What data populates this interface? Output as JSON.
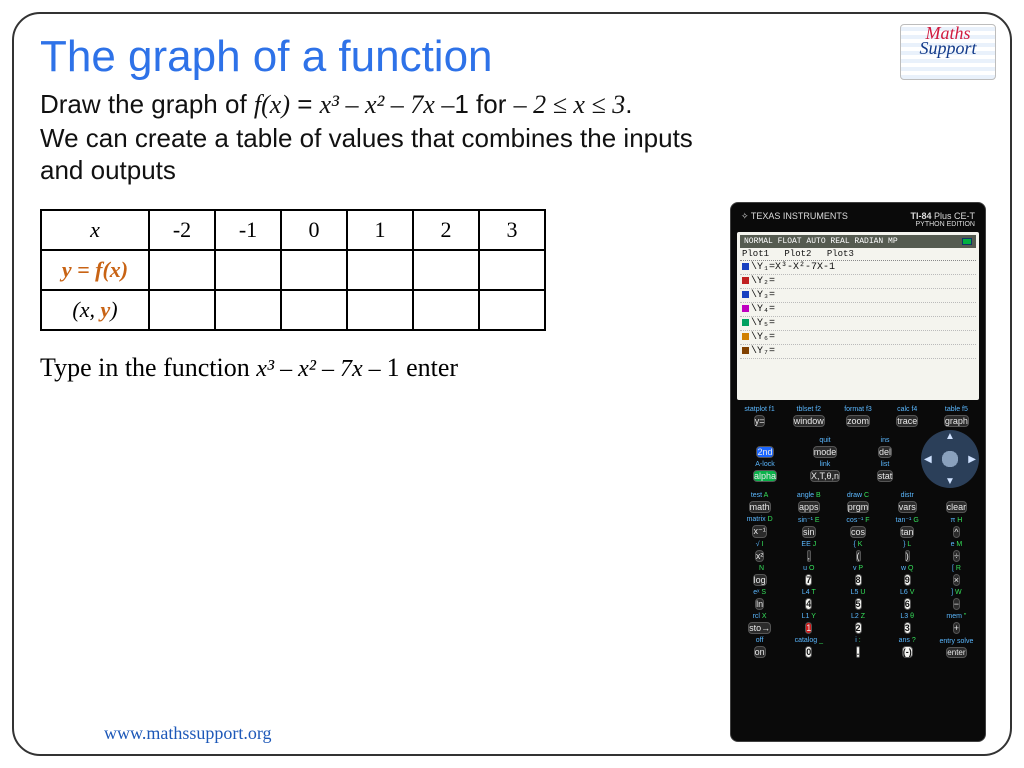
{
  "title": "The graph of a function",
  "logo": {
    "line1": "Maths",
    "line2": "Support"
  },
  "instruction": {
    "prefix": "Draw the graph of ",
    "fx_label": "f(x)",
    "equals": " = ",
    "expr_html": "x³ – x² – 7x –",
    "const": "1",
    "for_text": " for ",
    "domain": "– 2 ≤ x ≤ 3",
    "period": ".",
    "line2": "We can create a table of values that combines the inputs and outputs"
  },
  "table": {
    "row_x_label": "x",
    "row_y_label_pre": "y = ",
    "row_y_label_fx": "f(x)",
    "row_xy_label_open": "(",
    "row_xy_label_x": "x",
    "row_xy_label_sep": ", ",
    "row_xy_label_y": "y",
    "row_xy_label_close": ")",
    "x_values": [
      "-2",
      "-1",
      "0",
      "1",
      "2",
      "3"
    ]
  },
  "type_line": {
    "pre": "Type in the function  ",
    "expr": "x³ – x² – 7x – ",
    "const": "1",
    "post": "  enter"
  },
  "footer_url": "www.mathssupport.org",
  "calculator": {
    "brand_left": "TEXAS INSTRUMENTS",
    "brand_right_a": "TI-84",
    "brand_right_b": " Plus CE-T",
    "brand_sub": "PYTHON EDITION",
    "status": "NORMAL FLOAT AUTO REAL RADIAN MP",
    "plots": [
      "Plot1",
      "Plot2",
      "Plot3"
    ],
    "y1_expr": "\\Y₁=X³-X²-7X-1",
    "y_slots": [
      {
        "color": "#c02020",
        "label": "\\Y₂="
      },
      {
        "color": "#1840c0",
        "label": "\\Y₃="
      },
      {
        "color": "#c000c0",
        "label": "\\Y₄="
      },
      {
        "color": "#00a060",
        "label": "\\Y₅="
      },
      {
        "color": "#d08000",
        "label": "\\Y₆="
      },
      {
        "color": "#804000",
        "label": "\\Y₇="
      }
    ],
    "fkeys_labels": [
      "statplot  f1",
      "tblset  f2",
      "format  f3",
      "calc  f4",
      "table  f5"
    ],
    "fkeys": [
      "y=",
      "window",
      "zoom",
      "trace",
      "graph"
    ],
    "nav": {
      "second": "2nd",
      "mode": "mode",
      "del": "del",
      "alpha": "alpha",
      "xton": "X,T,θ,n",
      "stat": "stat",
      "lab_quit": "quit",
      "lab_ins": "ins",
      "lab_alock": "A-lock",
      "lab_link": "link",
      "lab_list": "list"
    },
    "rows": [
      {
        "labs": [
          "test  A",
          "angle  B",
          "draw  C",
          "distr",
          " "
        ],
        "keys": [
          "math",
          "apps",
          "prgm",
          "vars",
          "clear"
        ]
      },
      {
        "labs": [
          "matrix  D",
          "sin⁻¹  E",
          "cos⁻¹  F",
          "tan⁻¹  G",
          "π  H"
        ],
        "keys": [
          "x⁻¹",
          "sin",
          "cos",
          "tan",
          "^"
        ]
      },
      {
        "labs": [
          "√  I",
          "EE  J",
          "{  K",
          "}  L",
          "e  M"
        ],
        "keys": [
          "x²",
          ",",
          "(",
          ")",
          "÷"
        ]
      },
      {
        "labs": [
          "  N",
          "u  O",
          "v  P",
          "w  Q",
          "[  R"
        ],
        "keys": [
          "log",
          "7",
          "8",
          "9",
          "×"
        ]
      },
      {
        "labs": [
          "eˣ  S",
          "L4  T",
          "L5  U",
          "L6  V",
          "]  W"
        ],
        "keys": [
          "ln",
          "4",
          "5",
          "6",
          "−"
        ]
      },
      {
        "labs": [
          "rcl  X",
          "L1  Y",
          "L2  Z",
          "L3  θ",
          "mem  \""
        ],
        "keys": [
          "sto→",
          "1",
          "2",
          "3",
          "+"
        ]
      },
      {
        "labs": [
          "off",
          "catalog  _",
          "i  :",
          "ans  ?",
          "entry solve"
        ],
        "keys": [
          "on",
          "0",
          ".",
          "(-)",
          "enter"
        ]
      }
    ]
  }
}
